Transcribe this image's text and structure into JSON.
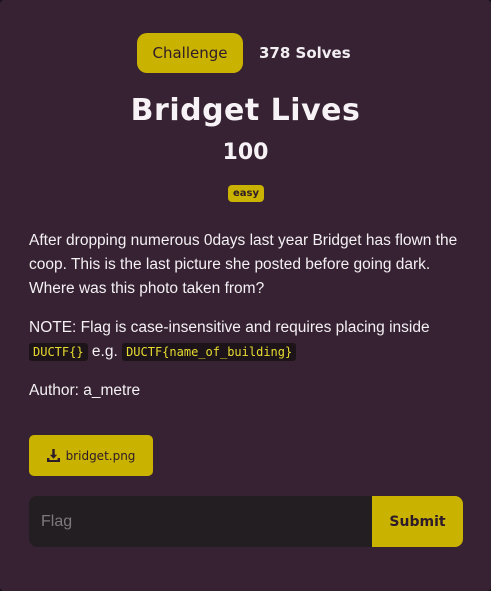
{
  "tabs": {
    "challenge_label": "Challenge",
    "solves_label": "378 Solves"
  },
  "challenge": {
    "name": "Bridget Lives",
    "points": "100",
    "difficulty": "easy",
    "description_p1": "After dropping numerous 0days last year Bridget has flown the coop. This is the last picture she posted before going dark. Where was this photo taken from?",
    "note_prefix": "NOTE: Flag is case-insensitive and requires placing inside",
    "note_code1": "DUCTF{}",
    "note_mid": "e.g.",
    "note_code2": "DUCTF{name_of_building}",
    "author": "Author: a_metre"
  },
  "files": [
    {
      "name": "bridget.png",
      "icon": "download-icon"
    }
  ],
  "flag_form": {
    "placeholder": "Flag",
    "submit_label": "Submit"
  },
  "colors": {
    "background": "#362233",
    "accent": "#c9b200",
    "text": "#f4f0f3",
    "input_bg": "#221e22"
  }
}
